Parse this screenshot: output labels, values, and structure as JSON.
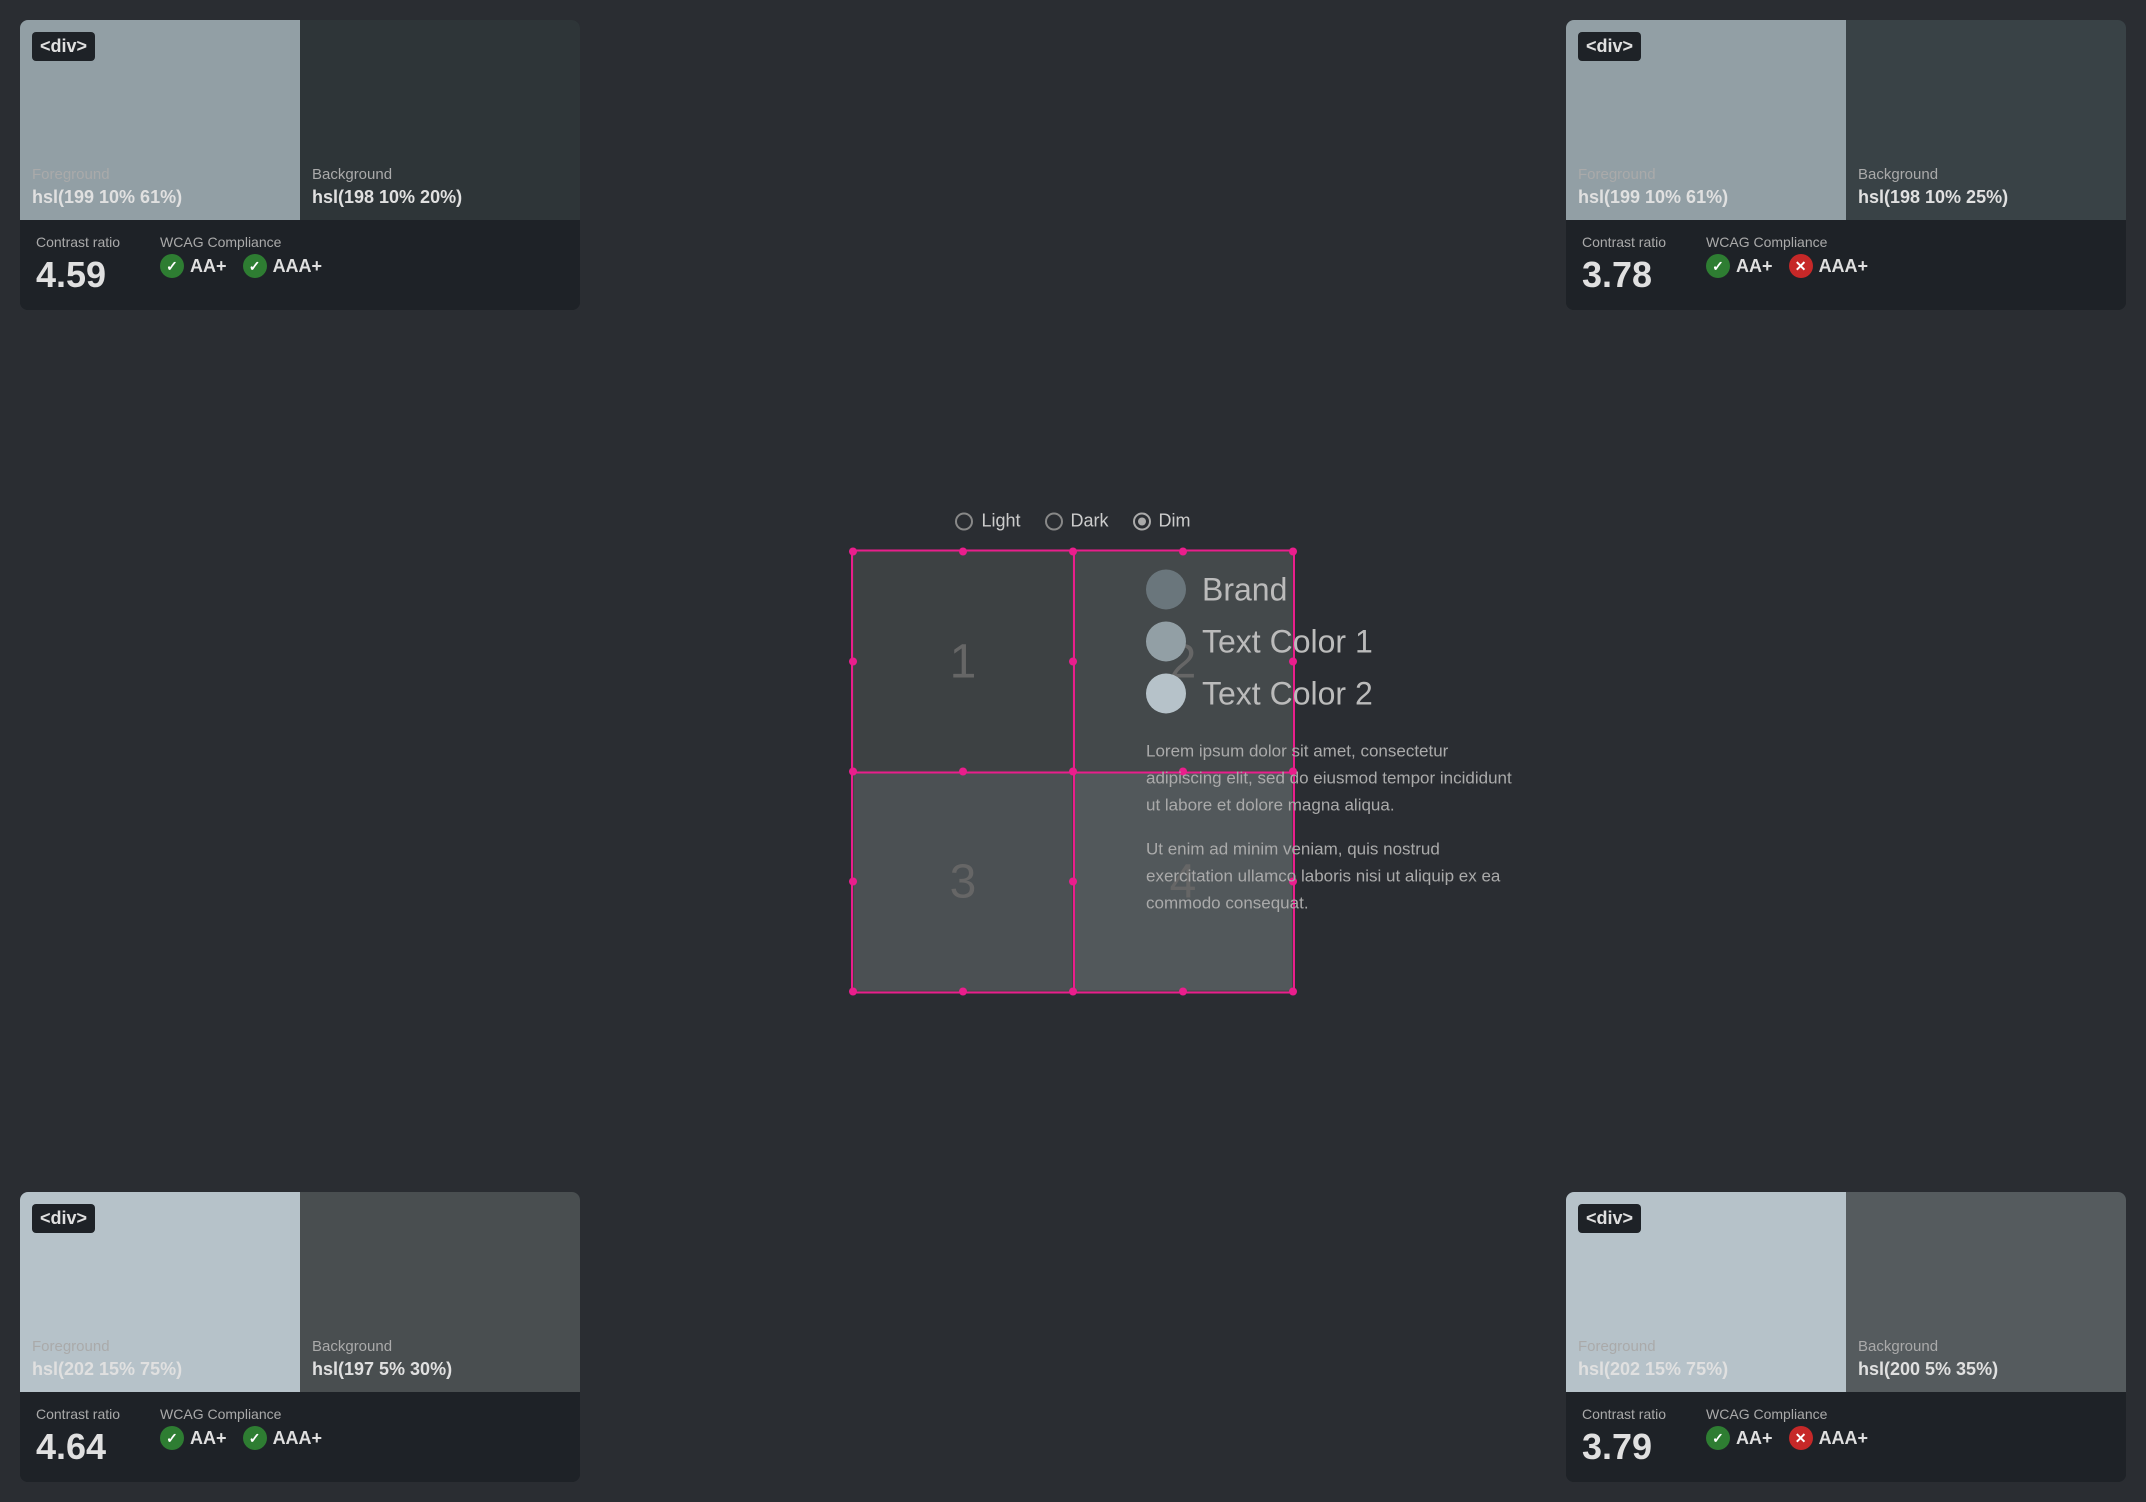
{
  "panels": {
    "tl": {
      "label": "<div>",
      "fg_label": "Foreground",
      "fg_value": "hsl(199 10% 61%)",
      "bg_label": "Background",
      "bg_value": "hsl(198 10% 20%)",
      "contrast_label": "Contrast ratio",
      "contrast_value": "4.59",
      "wcag_label": "WCAG Compliance",
      "badge_aa": "AA+",
      "badge_aaa": "AAA+",
      "aa_pass": true,
      "aaa_pass": true
    },
    "tr": {
      "label": "<div>",
      "fg_label": "Foreground",
      "fg_value": "hsl(199 10% 61%)",
      "bg_label": "Background",
      "bg_value": "hsl(198 10% 25%)",
      "contrast_label": "Contrast ratio",
      "contrast_value": "3.78",
      "wcag_label": "WCAG Compliance",
      "badge_aa": "AA+",
      "badge_aaa": "AAA+",
      "aa_pass": true,
      "aaa_pass": false
    },
    "bl": {
      "label": "<div>",
      "fg_label": "Foreground",
      "fg_value": "hsl(202 15% 75%)",
      "bg_label": "Background",
      "bg_value": "hsl(197 5% 30%)",
      "contrast_label": "Contrast ratio",
      "contrast_value": "4.64",
      "wcag_label": "WCAG Compliance",
      "badge_aa": "AA+",
      "badge_aaa": "AAA+",
      "aa_pass": true,
      "aaa_pass": true
    },
    "br": {
      "label": "<div>",
      "fg_label": "Foreground",
      "fg_value": "hsl(202 15% 75%)",
      "bg_label": "Background",
      "bg_value": "hsl(200 5% 35%)",
      "contrast_label": "Contrast ratio",
      "contrast_value": "3.79",
      "wcag_label": "WCAG Compliance",
      "badge_aa": "AA+",
      "badge_aaa": "AAA+",
      "aa_pass": true,
      "aaa_pass": false
    }
  },
  "radio": {
    "light_label": "Light",
    "dark_label": "Dark",
    "dim_label": "Dim",
    "selected": "Dim"
  },
  "grid": {
    "cell1": "1",
    "cell2": "2",
    "cell3": "3",
    "cell4": "4"
  },
  "legend": {
    "brand_label": "Brand",
    "text1_label": "Text Color 1",
    "text2_label": "Text Color 2"
  },
  "lorem": {
    "p1": "Lorem ipsum dolor sit amet, consectetur adipiscing elit, sed do eiusmod tempor incididunt ut labore et dolore magna aliqua.",
    "p2": "Ut enim ad minim veniam, quis nostrud exercitation ullamco laboris nisi ut aliquip ex ea commodo consequat."
  }
}
